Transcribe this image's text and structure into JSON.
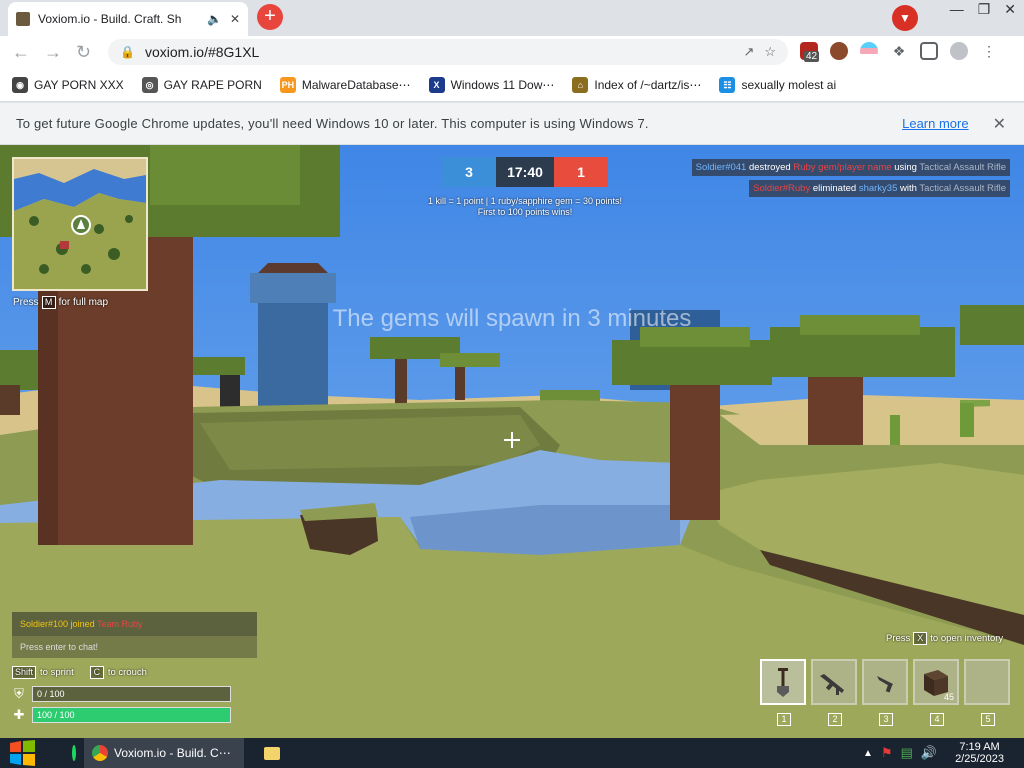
{
  "browser": {
    "tab_title": "Voxiom.io - Build. Craft. Sh",
    "url": "voxiom.io/#8G1XL",
    "extension_badge": "42",
    "bookmarks": [
      {
        "label": "GAY PORN XXX",
        "icon": "generic-site-icon",
        "color": "#444444",
        "glyph": "◉"
      },
      {
        "label": "GAY RAPE PORN",
        "icon": "globe-icon",
        "color": "#555555",
        "glyph": "◎"
      },
      {
        "label": "MalwareDatabase⋯",
        "icon": "ph-icon",
        "color": "#f7971d",
        "glyph": "PH"
      },
      {
        "label": "Windows 11 Dow⋯",
        "icon": "x-icon",
        "color": "#1d3b8c",
        "glyph": "X"
      },
      {
        "label": "Index of /~dartz/is⋯",
        "icon": "folder-icon",
        "color": "#8a6d1f",
        "glyph": "⌂"
      },
      {
        "label": "sexually molest ai",
        "icon": "ai-site-icon",
        "color": "#1a8fe3",
        "glyph": "☷"
      }
    ],
    "infobar_message": "To get future Google Chrome updates, you'll need Windows 10 or later. This computer is using Windows 7.",
    "infobar_link": "Learn more"
  },
  "game": {
    "map_hint": {
      "pre": "Press",
      "key": "M",
      "post": "for full map"
    },
    "score": {
      "blue": "3",
      "timer": "17:40",
      "red": "1"
    },
    "rules_line1": "1 kill = 1 point | 1 ruby/sapphire gem = 30 points!",
    "rules_line2": "First to 100 points wins!",
    "killfeed": [
      {
        "a": "Soldier#041",
        "verb": "destroyed",
        "b": "Ruby gem/player name",
        "mid": "using",
        "weapon": "Tactical Assault Rifle"
      },
      {
        "a": "Soldier#Ruby",
        "verb": "eliminated",
        "b": "sharky35",
        "mid": "with",
        "weapon": "Tactical Assault Rifle"
      }
    ],
    "announcement": "The gems will spawn in 3 minutes",
    "chat": {
      "player": "Soldier#100",
      "joined": "joined",
      "team": "Team Ruby",
      "placeholder": "Press enter to chat!"
    },
    "controls": {
      "sprint_key": "Shift",
      "sprint": "to sprint",
      "crouch_key": "C",
      "crouch": "to crouch"
    },
    "armor": {
      "label": "0 / 100",
      "value": 0,
      "max": 100,
      "color": "#5a5a3a"
    },
    "health": {
      "label": "100 / 100",
      "value": 100,
      "max": 100,
      "color": "#2ecc71"
    },
    "inventory_hint": {
      "pre": "Press",
      "key": "X",
      "post": "to open inventory"
    },
    "hotbar": [
      {
        "num": "1",
        "item": "shovel",
        "count": "",
        "selected": true
      },
      {
        "num": "2",
        "item": "assault-rifle",
        "count": "",
        "selected": false
      },
      {
        "num": "3",
        "item": "pistol",
        "count": "",
        "selected": false
      },
      {
        "num": "4",
        "item": "dirt-block",
        "count": "45",
        "selected": false
      },
      {
        "num": "5",
        "item": "empty",
        "count": "",
        "selected": false
      }
    ]
  },
  "taskbar": {
    "active_window": "Voxiom.io - Build. C⋯",
    "time": "7:19 AM",
    "date": "2/25/2023"
  }
}
